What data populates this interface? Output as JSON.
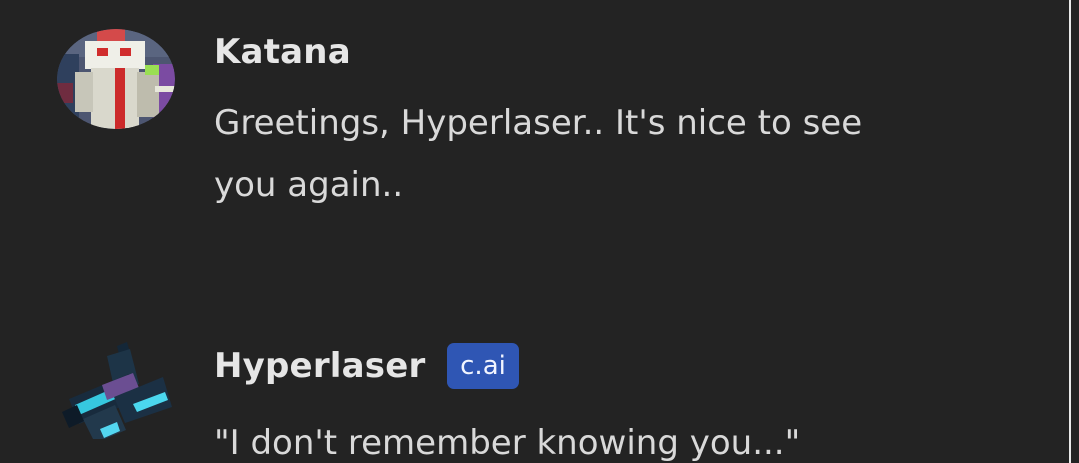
{
  "conversation": {
    "messages": [
      {
        "author": "Katana",
        "text": "Greetings, Hyperlaser.. It's nice to see you again.."
      },
      {
        "author": "Hyperlaser",
        "badge": "c.ai",
        "text": "\"I don't remember knowing you...\""
      }
    ]
  },
  "colors": {
    "background": "#232323",
    "author_text": "#e6e6e6",
    "message_text": "#d9d9d9",
    "badge_background": "#2f56b4",
    "edge_line": "#e9e9e9"
  },
  "icons": {
    "katana_avatar": "avatar-icon",
    "hyperlaser_avatar": "avatar-icon"
  }
}
